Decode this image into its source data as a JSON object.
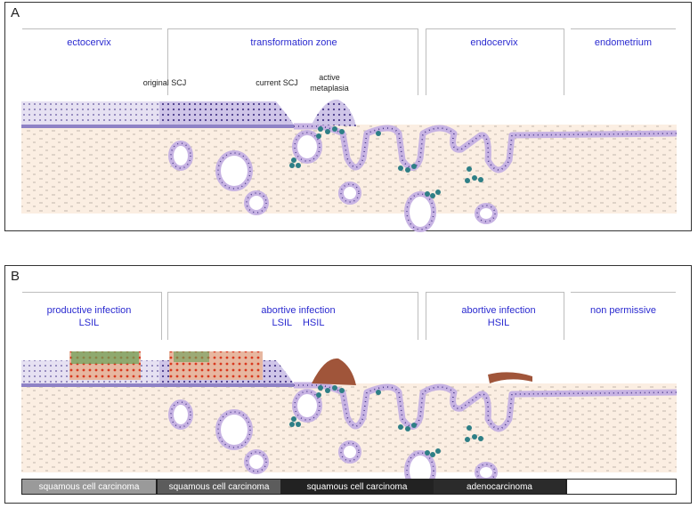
{
  "panel_a": {
    "letter": "A",
    "regions": {
      "ectocervix": "ectocervix",
      "transformation_zone": "transformation zone",
      "endocervix": "endocervix",
      "endometrium": "endometrium"
    },
    "labels": {
      "original_scj": "original SCJ",
      "current_scj": "current SCJ",
      "active_metaplasia_line1": "active",
      "active_metaplasia_line2": "metaplasia"
    }
  },
  "panel_b": {
    "letter": "B",
    "regions": {
      "productive_line1": "productive infection",
      "productive_line2": "LSIL",
      "abortive1_line1": "abortive infection",
      "abortive1_line2": "LSIL    HSIL",
      "abortive2_line1": "abortive infection",
      "abortive2_line2": "HSIL",
      "nonpermissive": "non permissive"
    },
    "cancer_bar": [
      {
        "label": "squamous cell carcinoma",
        "bg": "#9a9a9a",
        "fg": "#ffffff"
      },
      {
        "label": "squamous cell carcinoma",
        "bg": "#5c5c5c",
        "fg": "#ffffff"
      },
      {
        "label": "squamous cell carcinoma",
        "bg": "#222222",
        "fg": "#ffffff"
      },
      {
        "label": "adenocarcinoma",
        "bg": "#2b2b2b",
        "fg": "#ffffff"
      },
      {
        "label": "",
        "bg": "#ffffff",
        "fg": "#000000"
      }
    ]
  },
  "colors": {
    "region_text": "#2a2ad0",
    "stroma": "#fbeee2",
    "epithelium": "#b9a6d9",
    "columnar": "#c7b3e3",
    "nucleus": "#4a3a8a",
    "reserve": "#2e7f86",
    "hpv_red": "#d9381e",
    "hpv_green": "#6aa25a",
    "hsil_brown": "#a0553a"
  }
}
